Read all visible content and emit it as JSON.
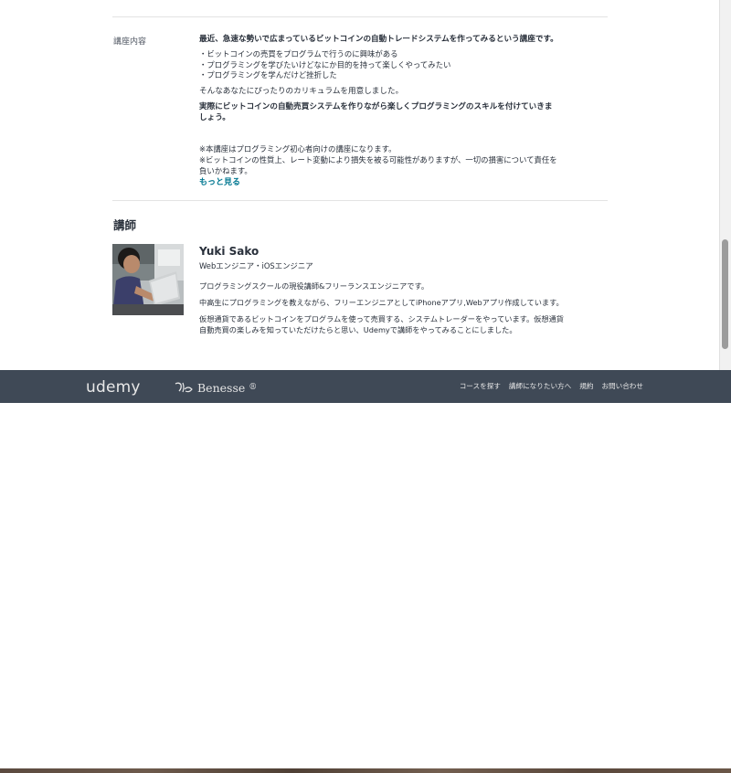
{
  "course_content": {
    "label": "講座内容",
    "headline": "最近、急速な勢いで広まっているビットコインの自動トレードシステムを作ってみるという講座です。",
    "bullets": [
      "・ビットコインの売買をプログラムで行うのに興味がある",
      "・プログラミングを学びたいけどなにか目的を持って楽しくやってみたい",
      "・プログラミングを学んだけど挫折した"
    ],
    "curriculum": "そんなあなたにぴったりのカリキュラムを用意しました。",
    "goal": "実際にビットコインの自動売買システムを作りながら楽しくプログラミングのスキルを付けていきましょう。",
    "note1": "※本講座はプログラミング初心者向けの講座になります。",
    "note2": "※ビットコインの性質上、レート変動により損失を被る可能性がありますが、一切の損害について責任を負いかねます。",
    "more_link": "もっと見る"
  },
  "instructor": {
    "heading": "講師",
    "name": "Yuki Sako",
    "title": "Webエンジニア・iOSエンジニア",
    "bio": [
      "プログラミングスクールの現役講師&フリーランスエンジニアです。",
      "中高生にプログラミングを教えながら、フリーエンジニアとしてiPhoneアプリ,Webアプリ作成しています。",
      "仮想通貨であるビットコインをプログラムを使って売買する、システムトレーダーをやっています。仮想通貨自動売買の楽しみを知っていただけたらと思い、Udemyで講師をやってみることにしました。"
    ]
  },
  "footer": {
    "logo_udemy": "udemy",
    "logo_benesse": "Benesse",
    "registered_mark": "®",
    "links": [
      "コースを探す",
      "講師になりたい方へ",
      "規約",
      "お問い合わせ"
    ]
  }
}
